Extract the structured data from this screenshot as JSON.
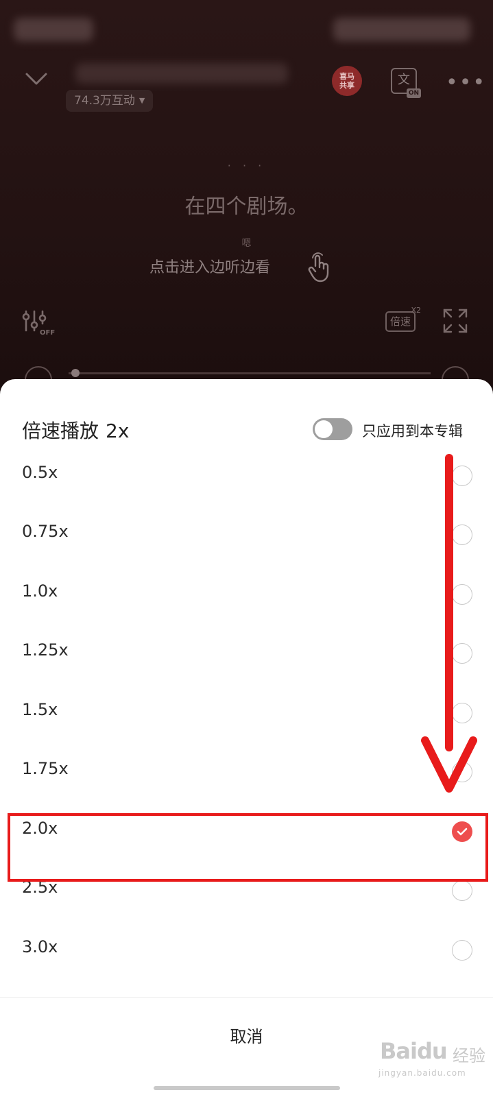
{
  "player": {
    "interaction_count": "74.3万互动",
    "badge_text": "喜马\n共享",
    "text_icon": "文",
    "text_icon_state": "ON",
    "more": "•••",
    "lyric_dots": "· · ·",
    "lyric_main": "在四个剧场。",
    "lyric_sub": "嗯",
    "lyric_hint": "点击进入边听边看",
    "speed_button": "倍速",
    "speed_badge": "X2"
  },
  "sheet": {
    "title": "倍速播放",
    "current_value": "2x",
    "toggle_label": "只应用到本专辑",
    "toggle_on": false,
    "options": [
      {
        "label": "0.5x",
        "selected": false
      },
      {
        "label": "0.75x",
        "selected": false
      },
      {
        "label": "1.0x",
        "selected": false
      },
      {
        "label": "1.25x",
        "selected": false
      },
      {
        "label": "1.5x",
        "selected": false
      },
      {
        "label": "1.75x",
        "selected": false
      },
      {
        "label": "2.0x",
        "selected": true
      },
      {
        "label": "2.5x",
        "selected": false
      },
      {
        "label": "3.0x",
        "selected": false
      }
    ],
    "cancel_label": "取消"
  },
  "watermark": {
    "logo": "Baidu",
    "cn": "经验",
    "url": "jingyan.baidu.com"
  },
  "colors": {
    "accent": "#ee4e4e",
    "annotation": "#e81b1b"
  }
}
